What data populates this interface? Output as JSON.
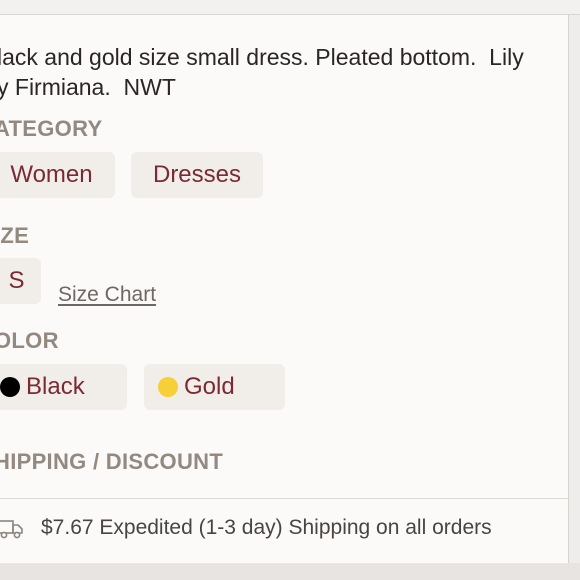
{
  "description": {
    "line1": "lack and gold size small dress. Pleated bottom.  Lily",
    "line2": "y Firmiana.  NWT"
  },
  "category": {
    "label": "ATEGORY",
    "chips": [
      "Women",
      "Dresses"
    ]
  },
  "size": {
    "label": "IZE",
    "value": "S",
    "size_chart_label": "Size Chart"
  },
  "color": {
    "label": "OLOR",
    "options": [
      {
        "name": "Black",
        "swatch": "#000000"
      },
      {
        "name": "Gold",
        "swatch": "#f7cf36"
      }
    ]
  },
  "shipping": {
    "label": "HIPPING / DISCOUNT",
    "icon": "truck-icon",
    "text": "$7.67 Expedited (1-3 day) Shipping on all orders"
  },
  "colors": {
    "accent": "#7a2a34",
    "label_gray": "#938980",
    "chip_bg": "#f1eeea"
  }
}
